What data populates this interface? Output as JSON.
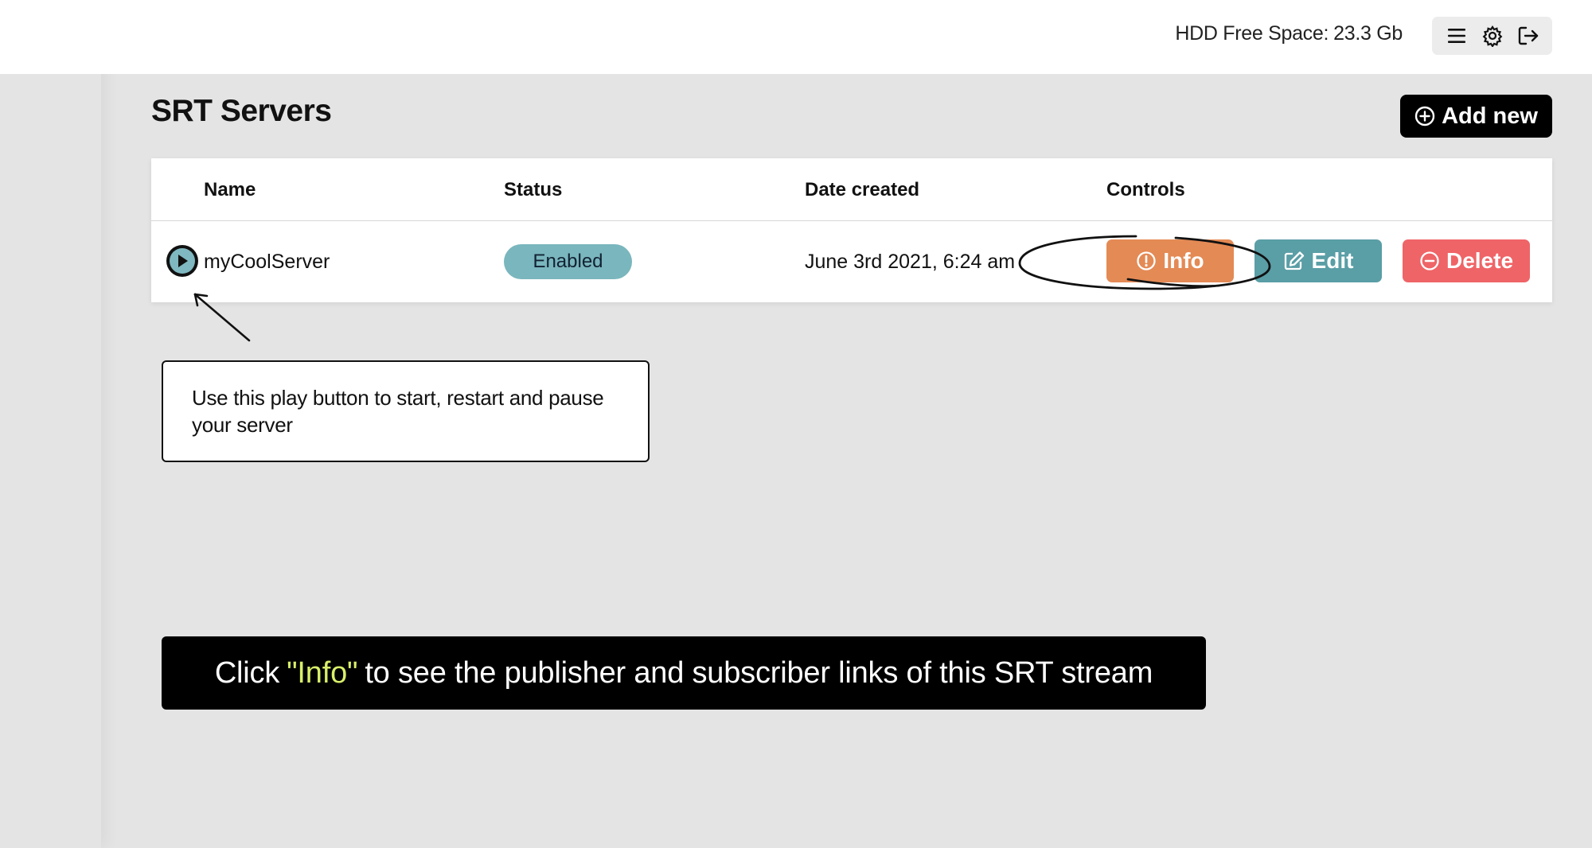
{
  "header": {
    "hdd_label": "HDD Free Space:",
    "hdd_value": "23.3 Gb",
    "icons": [
      "menu-icon",
      "gear-icon",
      "logout-icon"
    ]
  },
  "page": {
    "title": "SRT Servers",
    "add_new_label": "Add new"
  },
  "table": {
    "columns": [
      "Name",
      "Status",
      "Date created",
      "Controls"
    ],
    "rows": [
      {
        "name": "myCoolServer",
        "status": "Enabled",
        "date_created": "June 3rd 2021, 6:24 am",
        "controls": {
          "info": "Info",
          "edit": "Edit",
          "delete": "Delete"
        }
      }
    ]
  },
  "annotations": {
    "tooltip": "Use this play button to start, restart and pause your server",
    "banner_before": "Click",
    "banner_highlight": "\"Info\"",
    "banner_after": "to see the publisher and subscriber links of this SRT stream"
  },
  "colors": {
    "info": "#e48a55",
    "edit": "#5a9ea6",
    "delete": "#ef6467",
    "enabled_badge": "#7ab6bd",
    "banner_highlight": "#d8ef6a"
  }
}
